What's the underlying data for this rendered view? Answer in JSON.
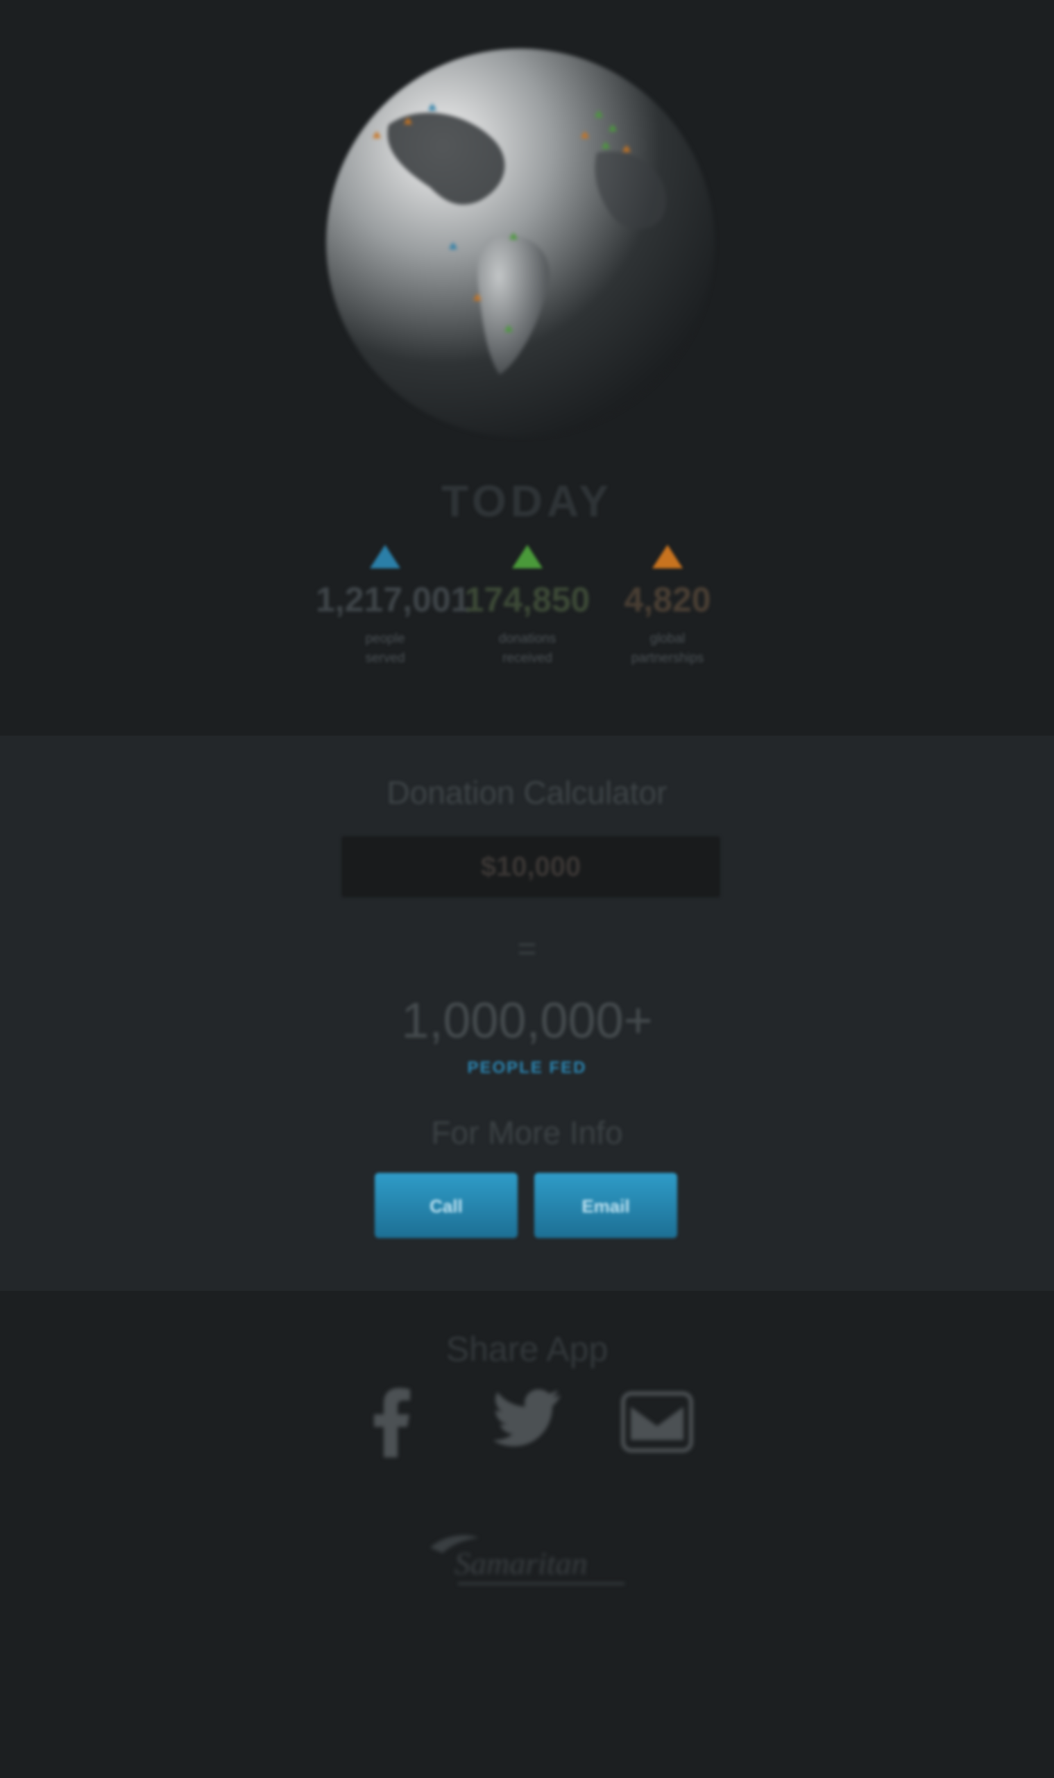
{
  "colors": {
    "blue": "#2b7fa8",
    "green": "#4a9a3a",
    "orange": "#c8731f",
    "accent": "#2b86b3"
  },
  "header": {
    "title": "TODAY"
  },
  "stats": [
    {
      "value": "1,217,001",
      "label": "people\nserved",
      "color": "#2b7fa8"
    },
    {
      "value": "174,850",
      "label": "donations\nreceived",
      "color": "#4a9a3a"
    },
    {
      "value": "4,820",
      "label": "global\npartnerships",
      "color": "#c8731f"
    }
  ],
  "calculator": {
    "title": "Donation Calculator",
    "amount": "$10,000",
    "equals": "=",
    "result": "1,000,000+",
    "result_label": "PEOPLE FED",
    "more_info": "For More Info",
    "call_label": "Call",
    "email_label": "Email"
  },
  "share": {
    "title": "Share App",
    "icons": [
      "facebook-icon",
      "twitter-icon",
      "email-icon"
    ]
  },
  "logo": {
    "text": "Samaritan"
  }
}
